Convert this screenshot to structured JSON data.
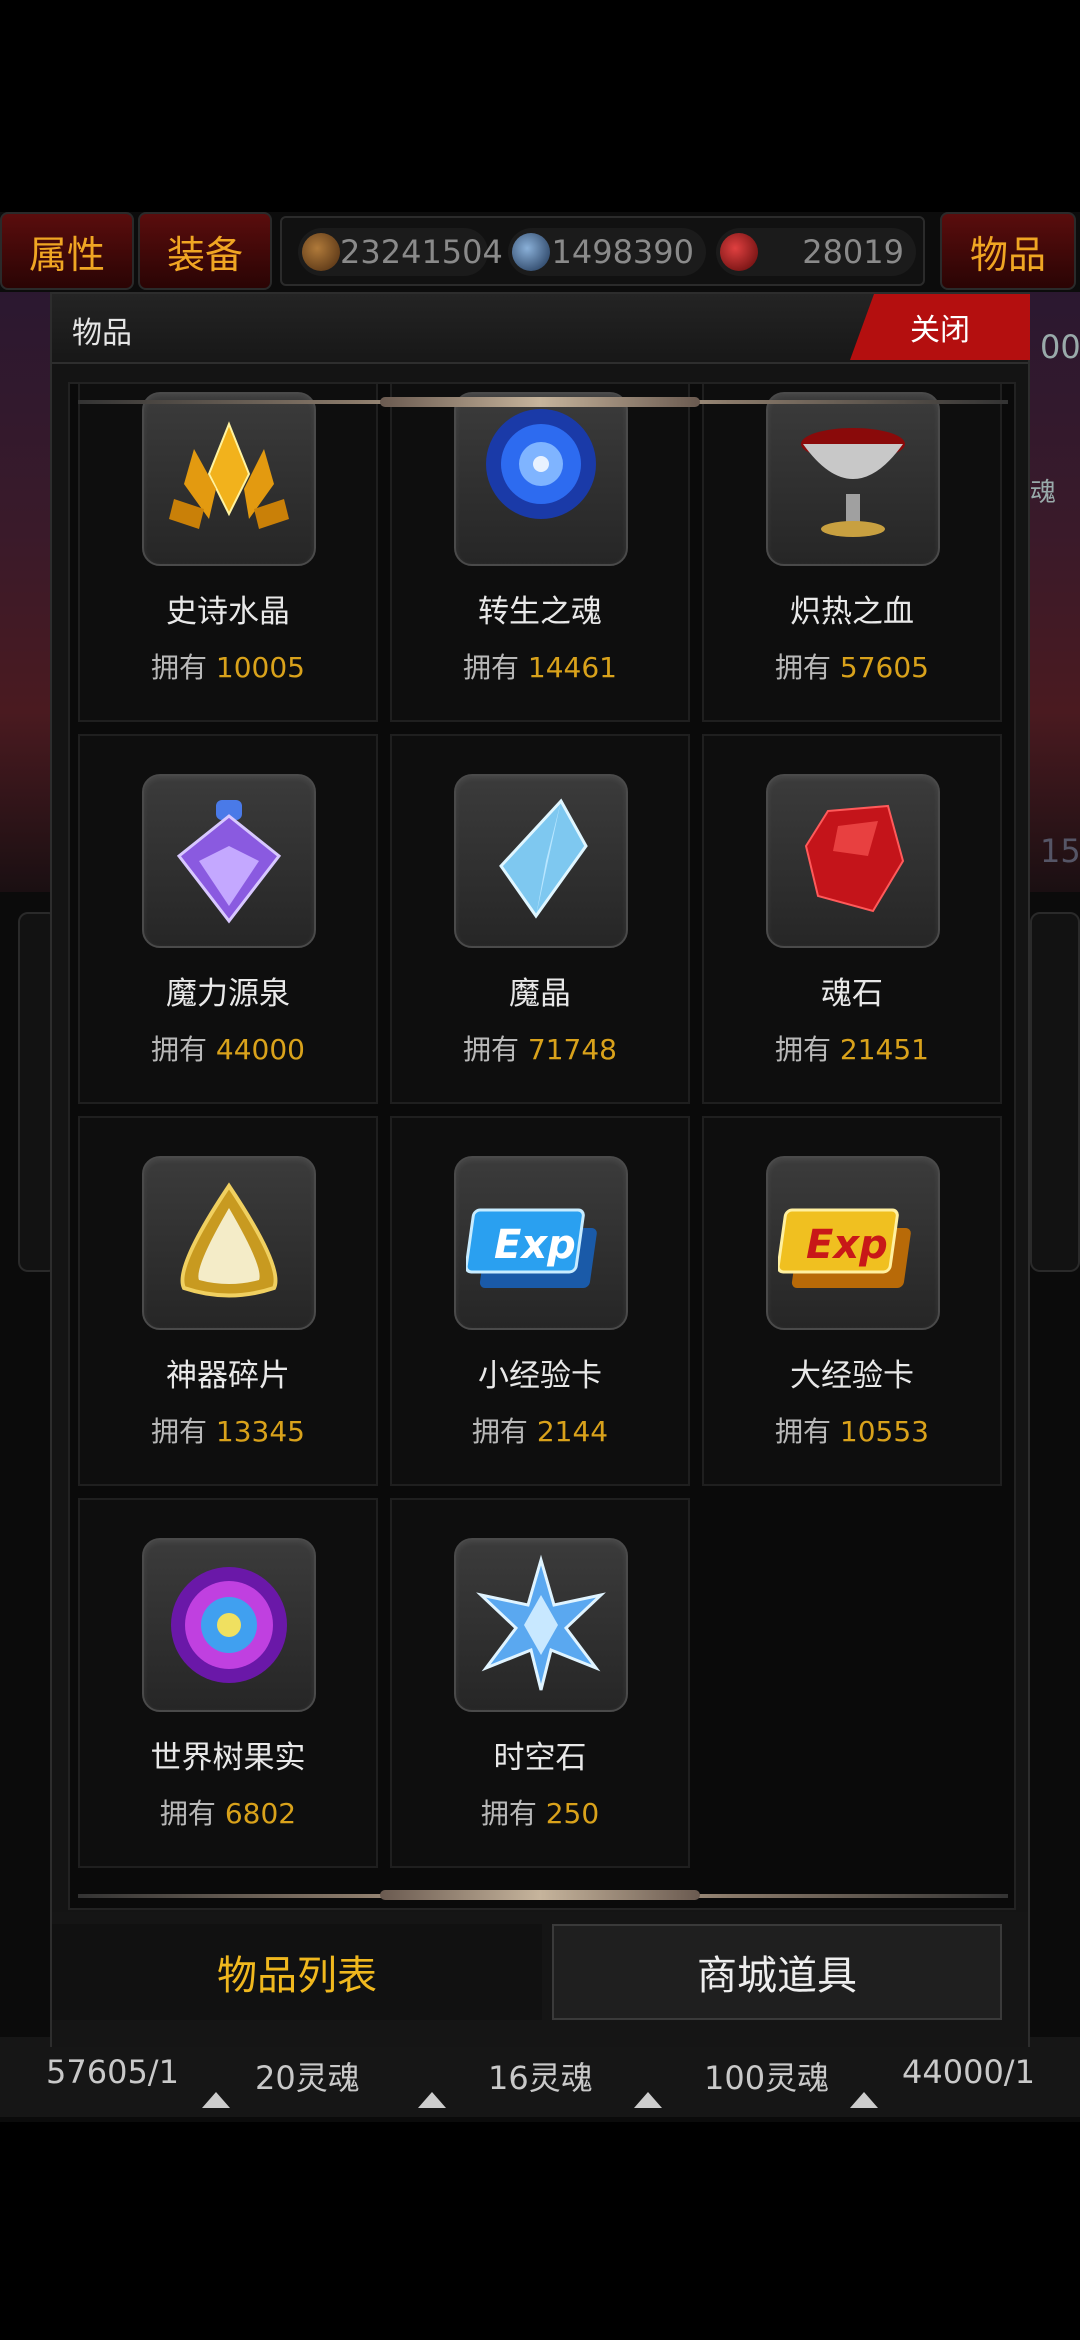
{
  "top_tabs": {
    "attributes": "属性",
    "equipment": "装备",
    "items": "物品"
  },
  "resources": [
    {
      "icon": "copper-coin-icon",
      "value": "23241504",
      "color": "#7a4a1a"
    },
    {
      "icon": "blue-gem-icon",
      "value": "1498390",
      "color": "#3a6a9a"
    },
    {
      "icon": "red-soul-icon",
      "value": "28019",
      "color": "#a01818"
    }
  ],
  "background": {
    "right_numbers": [
      "00",
      "魂",
      "15"
    ],
    "bottom_row": [
      "57605/1",
      "20灵魂",
      "16灵魂",
      "100灵魂",
      "44000/1"
    ]
  },
  "modal": {
    "title": "物品",
    "close_label": "关闭",
    "owned_label": "拥有",
    "items": [
      {
        "name": "史诗水晶",
        "count": "10005",
        "icon": "epic-crystal-icon"
      },
      {
        "name": "转生之魂",
        "count": "14461",
        "icon": "rebirth-soul-icon"
      },
      {
        "name": "炽热之血",
        "count": "57605",
        "icon": "blood-chalice-icon"
      },
      {
        "name": "魔力源泉",
        "count": "44000",
        "icon": "mana-potion-icon"
      },
      {
        "name": "魔晶",
        "count": "71748",
        "icon": "magic-crystal-icon"
      },
      {
        "name": "魂石",
        "count": "21451",
        "icon": "soul-stone-icon"
      },
      {
        "name": "神器碎片",
        "count": "13345",
        "icon": "artifact-shard-icon"
      },
      {
        "name": "小经验卡",
        "count": "2144",
        "icon": "small-exp-card-icon"
      },
      {
        "name": "大经验卡",
        "count": "10553",
        "icon": "large-exp-card-icon"
      },
      {
        "name": "世界树果实",
        "count": "6802",
        "icon": "world-tree-fruit-icon"
      },
      {
        "name": "时空石",
        "count": "250",
        "icon": "spacetime-stone-icon"
      }
    ],
    "bottom_tabs": {
      "item_list": "物品列表",
      "mall_items": "商城道具"
    },
    "exp_label": "Exp"
  }
}
